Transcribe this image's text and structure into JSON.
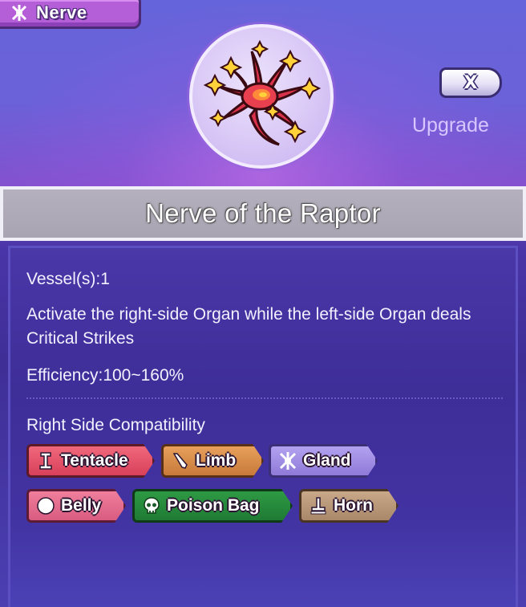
{
  "category_tag": {
    "icon": "nerve-icon",
    "label": "Nerve"
  },
  "item": {
    "icon": "raptor-nerve-icon",
    "name": "Nerve of the Raptor"
  },
  "actions": {
    "close_label": "X",
    "upgrade_label": "Upgrade"
  },
  "details": {
    "vessels": "Vessel(s):1",
    "description": "Activate the right-side Organ while the left-side Organ deals Critical Strikes",
    "efficiency": "Efficiency:100~160%",
    "compatibility_heading": "Right Side Compatibility"
  },
  "compatibility": [
    {
      "label": "Tentacle",
      "icon": "tentacle-icon",
      "color": "#e0506a"
    },
    {
      "label": "Limb",
      "icon": "limb-icon",
      "color": "#d88c4a"
    },
    {
      "label": "Gland",
      "icon": "gland-icon",
      "color": "#a08ee6"
    },
    {
      "label": "Belly",
      "icon": "belly-icon",
      "color": "#e46a8c"
    },
    {
      "label": "Poison Bag",
      "icon": "skull-icon",
      "color": "#268a3c"
    },
    {
      "label": "Horn",
      "icon": "horn-icon",
      "color": "#b89878"
    }
  ]
}
